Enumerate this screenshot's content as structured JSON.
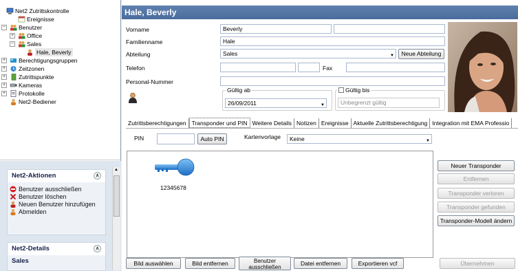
{
  "tree": {
    "items": [
      {
        "label": "Net2 Zutrittskontrolle",
        "icon": "computer-icon",
        "expander": "",
        "indent": 0
      },
      {
        "label": "Ereignisse",
        "icon": "calendar-icon",
        "expander": "",
        "indent": 1
      },
      {
        "label": "Benutzer",
        "icon": "users-icon",
        "expander": "−",
        "indent": 0
      },
      {
        "label": "Office",
        "icon": "users-icon",
        "expander": "+",
        "indent": 1
      },
      {
        "label": "Sales",
        "icon": "users-icon",
        "expander": "−",
        "indent": 1
      },
      {
        "label": "Hale, Beverly",
        "icon": "user-icon",
        "expander": "",
        "indent": 2
      },
      {
        "label": "Berechtigungsgruppen",
        "icon": "key-group-icon",
        "expander": "+",
        "indent": 0
      },
      {
        "label": "Zeitzonen",
        "icon": "clock-icon",
        "expander": "+",
        "indent": 0
      },
      {
        "label": "Zutrittspunkte",
        "icon": "door-icon",
        "expander": "+",
        "indent": 0
      },
      {
        "label": "Kameras",
        "icon": "camera-icon",
        "expander": "+",
        "indent": 0
      },
      {
        "label": "Protokolle",
        "icon": "report-icon",
        "expander": "+",
        "indent": 0
      },
      {
        "label": "Net2-Bediener",
        "icon": "operator-icon",
        "expander": "",
        "indent": 0
      }
    ]
  },
  "actions": {
    "title": "Net2-Aktionen",
    "items": [
      {
        "label": "Benutzer ausschließen",
        "icon": "no-entry-icon"
      },
      {
        "label": "Benutzer löschen",
        "icon": "delete-x-icon"
      },
      {
        "label": "Neuen Benutzer hinzufügen",
        "icon": "add-user-icon"
      },
      {
        "label": "Abmelden",
        "icon": "logout-icon"
      }
    ]
  },
  "details": {
    "title": "Net2-Details",
    "value": "Sales"
  },
  "header": {
    "title": "Hale, Beverly"
  },
  "form": {
    "vorname_label": "Vorname",
    "vorname_value": "Beverly",
    "familienname_label": "Familienname",
    "familienname_value": "Hale",
    "abteilung_label": "Abteilung",
    "abteilung_value": "Sales",
    "neue_abteilung_label": "Neue Abteilung",
    "telefon_label": "Telefon",
    "fax_label": "Fax",
    "personal_label": "Personal-Nummer",
    "gueltig_ab_label": "Gültig ab",
    "gueltig_ab_value": "26/09/2011",
    "gueltig_bis_label": "Gültig bis",
    "gueltig_bis_value": "Unbegrenzt gültig"
  },
  "tabs": [
    {
      "label": "Zutrittsberechtigungen",
      "active": false
    },
    {
      "label": "Transponder und PIN",
      "active": true
    },
    {
      "label": "Weitere Details",
      "active": false
    },
    {
      "label": "Notizen",
      "active": false
    },
    {
      "label": "Ereignisse",
      "active": false
    },
    {
      "label": "Aktuelle Zutrittsberechtigung",
      "active": false
    },
    {
      "label": "Integration mit EMA Professio",
      "active": false
    }
  ],
  "transponder": {
    "pin_label": "PIN",
    "pin_value": "",
    "auto_pin_label": "Auto PIN",
    "kartenvorlage_label": "Kartenvorlage",
    "kartenvorlage_value": "Keine",
    "card_number": "12345678",
    "buttons": {
      "neuer": "Neuer Transponder",
      "entfernen": "Entfernen",
      "verloren": "Transponder verloren",
      "gefunden": "Transponder gefunden",
      "modell": "Transponder-Modell ändern"
    }
  },
  "bottom": {
    "bild_auswaehlen": "Bild auswählen",
    "bild_entfernen": "Bild entfernen",
    "benutzer_ausschliessen": "Benutzer ausschließen",
    "datei_entfernen": "Datei entfernen",
    "exportieren": "Exportieren vcf",
    "uebernehmen": "Übernehmen"
  },
  "colors": {
    "title_bar": "#4f72a3",
    "key_blue": "#2f7fd3"
  }
}
